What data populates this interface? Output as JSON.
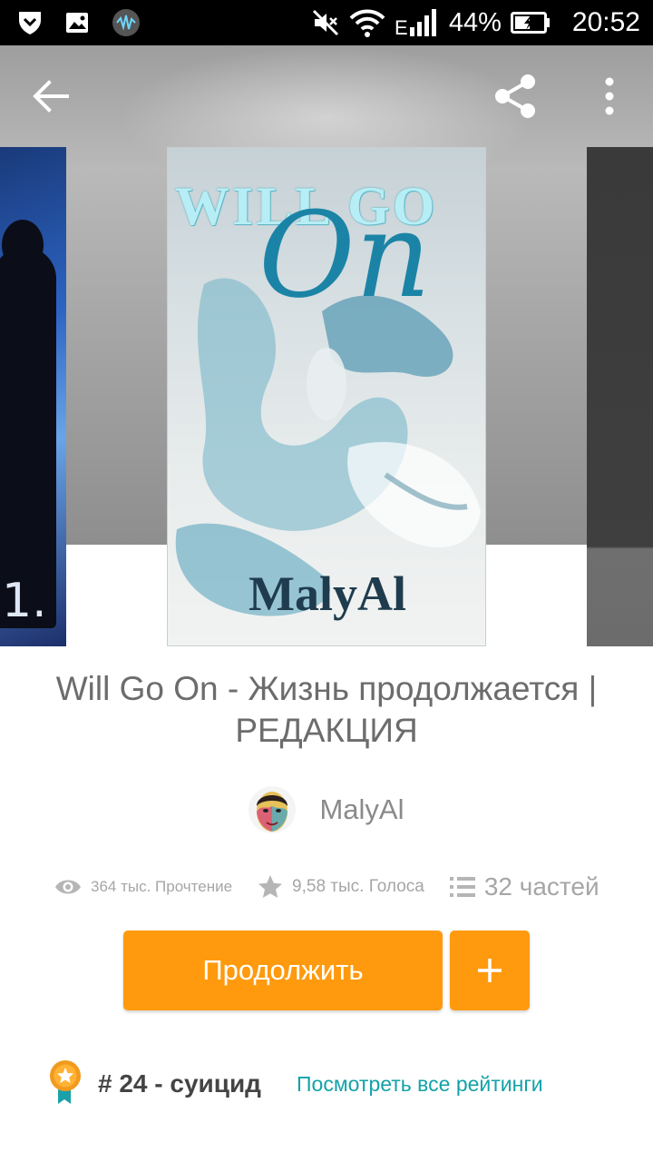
{
  "status_bar": {
    "battery_percent": "44%",
    "time": "20:52",
    "icons": [
      "shield-icon",
      "image-icon",
      "audio-app-icon",
      "mute-icon",
      "wifi-icon",
      "signal-icon",
      "battery-charging-icon"
    ]
  },
  "app_bar": {
    "back_icon": "arrow-left-icon",
    "share_icon": "share-icon",
    "more_icon": "more-vertical-icon"
  },
  "covers": {
    "main": {
      "title_line1": "WILL GO",
      "title_line2": "On",
      "author": "MalyAl"
    },
    "left_peek_text": "1."
  },
  "story": {
    "title": "Will Go On - Жизнь продолжается | РЕДАКЦИЯ",
    "author": "MalyAl"
  },
  "stats": {
    "reads": "364 тыс. Прочтение",
    "votes": "9,58 тыс. Голоса",
    "parts": "32 частей"
  },
  "actions": {
    "continue_label": "Продолжить",
    "add_icon": "plus-icon"
  },
  "ranking": {
    "rank": "# 24 - суицид",
    "view_all": "Посмотреть все рейтинги"
  },
  "colors": {
    "accent": "#ff9a0e",
    "link": "#13a2a8",
    "text_muted": "#a6a6a6"
  }
}
